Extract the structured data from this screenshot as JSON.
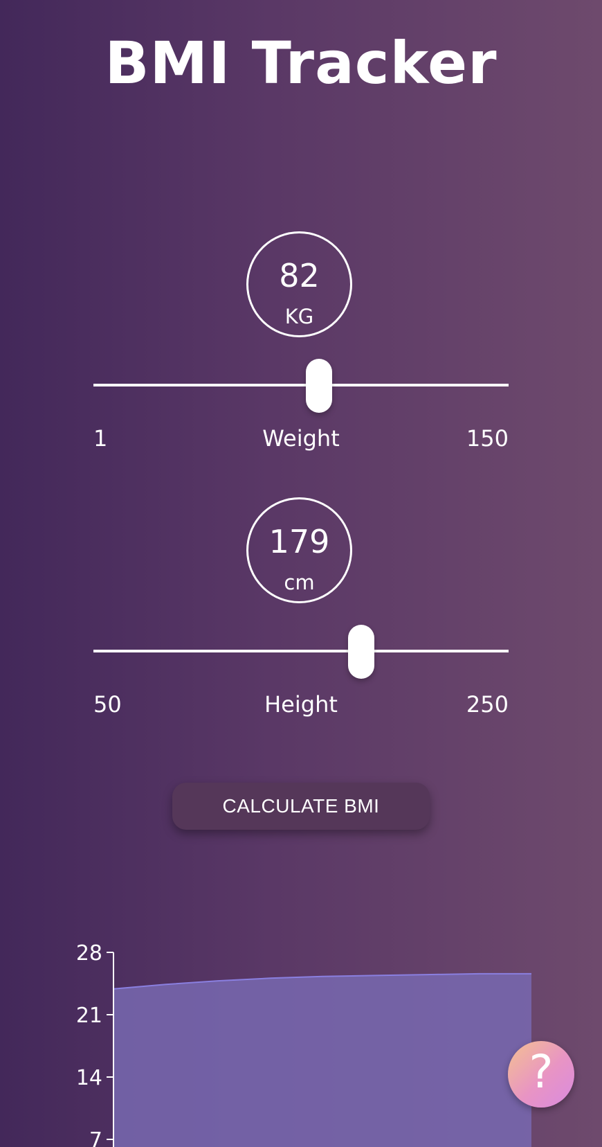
{
  "app": {
    "title": "BMI Tracker"
  },
  "weight": {
    "value": "82",
    "unit": "KG",
    "min": "1",
    "max": "150",
    "label": "Weight",
    "level": 0.5436
  },
  "height": {
    "value": "179",
    "unit": "cm",
    "min": "50",
    "max": "250",
    "label": "Height",
    "level": 0.645
  },
  "actions": {
    "calculate_label": "CALCULATE BMI",
    "help_label": "?"
  },
  "colors": {
    "background_start": "#43285a",
    "background_end": "#6e4a6d",
    "chart_fill": "#7868b0",
    "chart_line": "#8a7fe0",
    "help_gradient_start": "#f4c190",
    "help_gradient_end": "#d98be0"
  },
  "chart_data": {
    "type": "area",
    "y_ticks": [
      "28",
      "21",
      "14",
      "7"
    ],
    "ylim": [
      0,
      28
    ],
    "series": [
      {
        "values": [
          23.9,
          24.4,
          24.8,
          25.1,
          25.3,
          25.4,
          25.5,
          25.6,
          25.6
        ]
      }
    ],
    "grid": false
  }
}
